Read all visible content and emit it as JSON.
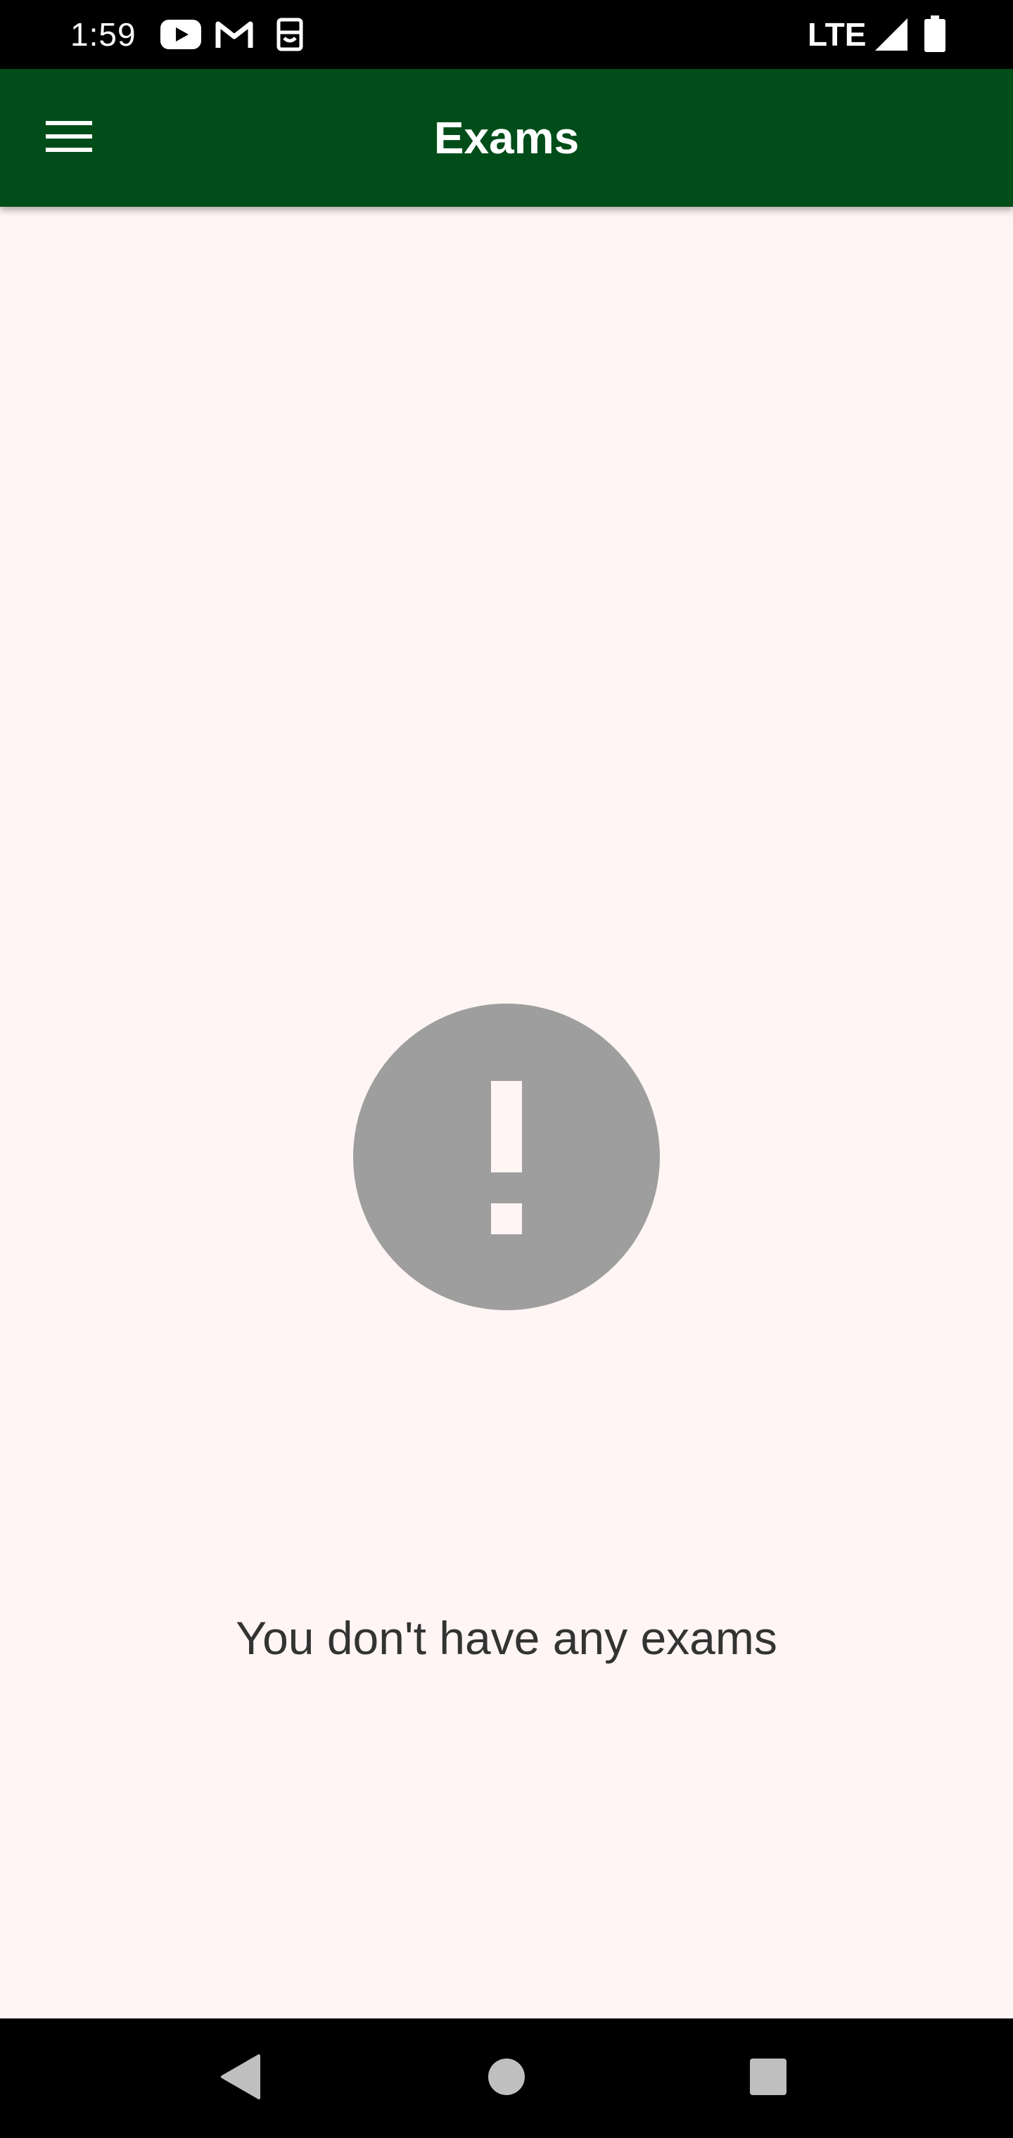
{
  "status_bar": {
    "time": "1:59",
    "network": "LTE",
    "notification_icons": [
      "youtube-icon",
      "gmail-icon",
      "sim-notification-icon"
    ],
    "system_icons": [
      "signal-icon",
      "battery-icon"
    ]
  },
  "app_bar": {
    "title": "Exams",
    "menu_icon": "hamburger-menu-icon",
    "color": "#004d19"
  },
  "empty_state": {
    "icon": "alert-circle-icon",
    "message": "You don't have any exams",
    "icon_color": "#9e9e9e"
  },
  "nav_bar": {
    "buttons": [
      "back-icon",
      "home-icon",
      "recents-icon"
    ]
  },
  "colors": {
    "background": "#fff5f4",
    "status_bar": "#000000",
    "text": "#333333"
  }
}
